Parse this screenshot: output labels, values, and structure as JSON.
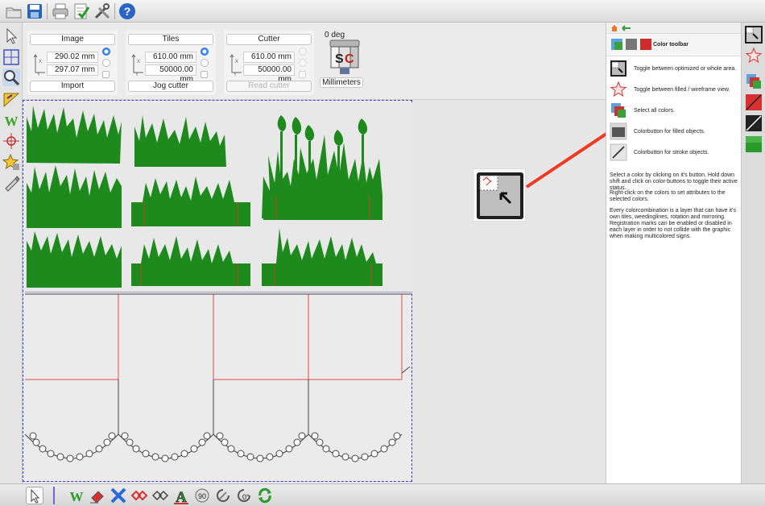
{
  "params": {
    "image": {
      "title": "Image",
      "x_value": "290.02 mm",
      "y_value": "297.07 mm",
      "action": "Import"
    },
    "tiles": {
      "title": "Tiles",
      "x_value": "610.00 mm",
      "y_value": "50000.00 mm",
      "action": "Jog cutter"
    },
    "cutter": {
      "title": "Cutter",
      "x_value": "610.00 mm",
      "y_value": "50000.00 mm",
      "action": "Read cutter"
    },
    "rotation": "0 deg",
    "units": "Millimeters"
  },
  "help": {
    "title": "Color toolbar",
    "rows": [
      {
        "text": "Toggle between optimized or whole area."
      },
      {
        "text": "Toggle between filled / wireframe view."
      },
      {
        "text": "Select all colors."
      },
      {
        "text": "Colorbutton for filled objects."
      },
      {
        "text": "Colorbutton for stroke objects."
      }
    ],
    "paragraphs": [
      "Select a color by clicking on it's button. Hold down shift and click on color-buttons to toggle their active status.",
      "Right-click on the colors to set attributes to the selected colors.",
      "Every colorcombination is a layer that can have it's own tiles, weedinglines, rotation and mirroring. Registration marks can be enabled or disabled in each layer in order to not collide with the graphic when making multicolored signs."
    ]
  },
  "colors": {
    "grass": "#1e8a1e",
    "arrow": "#f03a22",
    "selection": "#3b3bd6"
  }
}
